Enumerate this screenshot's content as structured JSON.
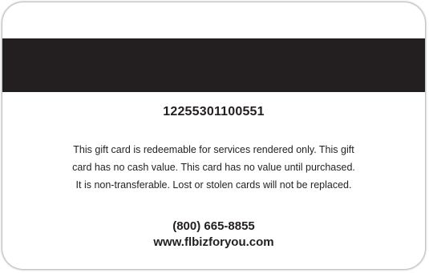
{
  "card": {
    "number": "12255301100551",
    "terms_lines": [
      "This gift card is redeemable for services rendered only. This gift",
      "card has no cash value. This card has no value until purchased.",
      "It is non-transferable. Lost or stolen cards will not be replaced."
    ],
    "phone": "(800) 665-8855",
    "website": "www.flbizforyou.com"
  },
  "colors": {
    "stripe": "#231f20",
    "text": "#231f20",
    "background": "#ffffff"
  }
}
